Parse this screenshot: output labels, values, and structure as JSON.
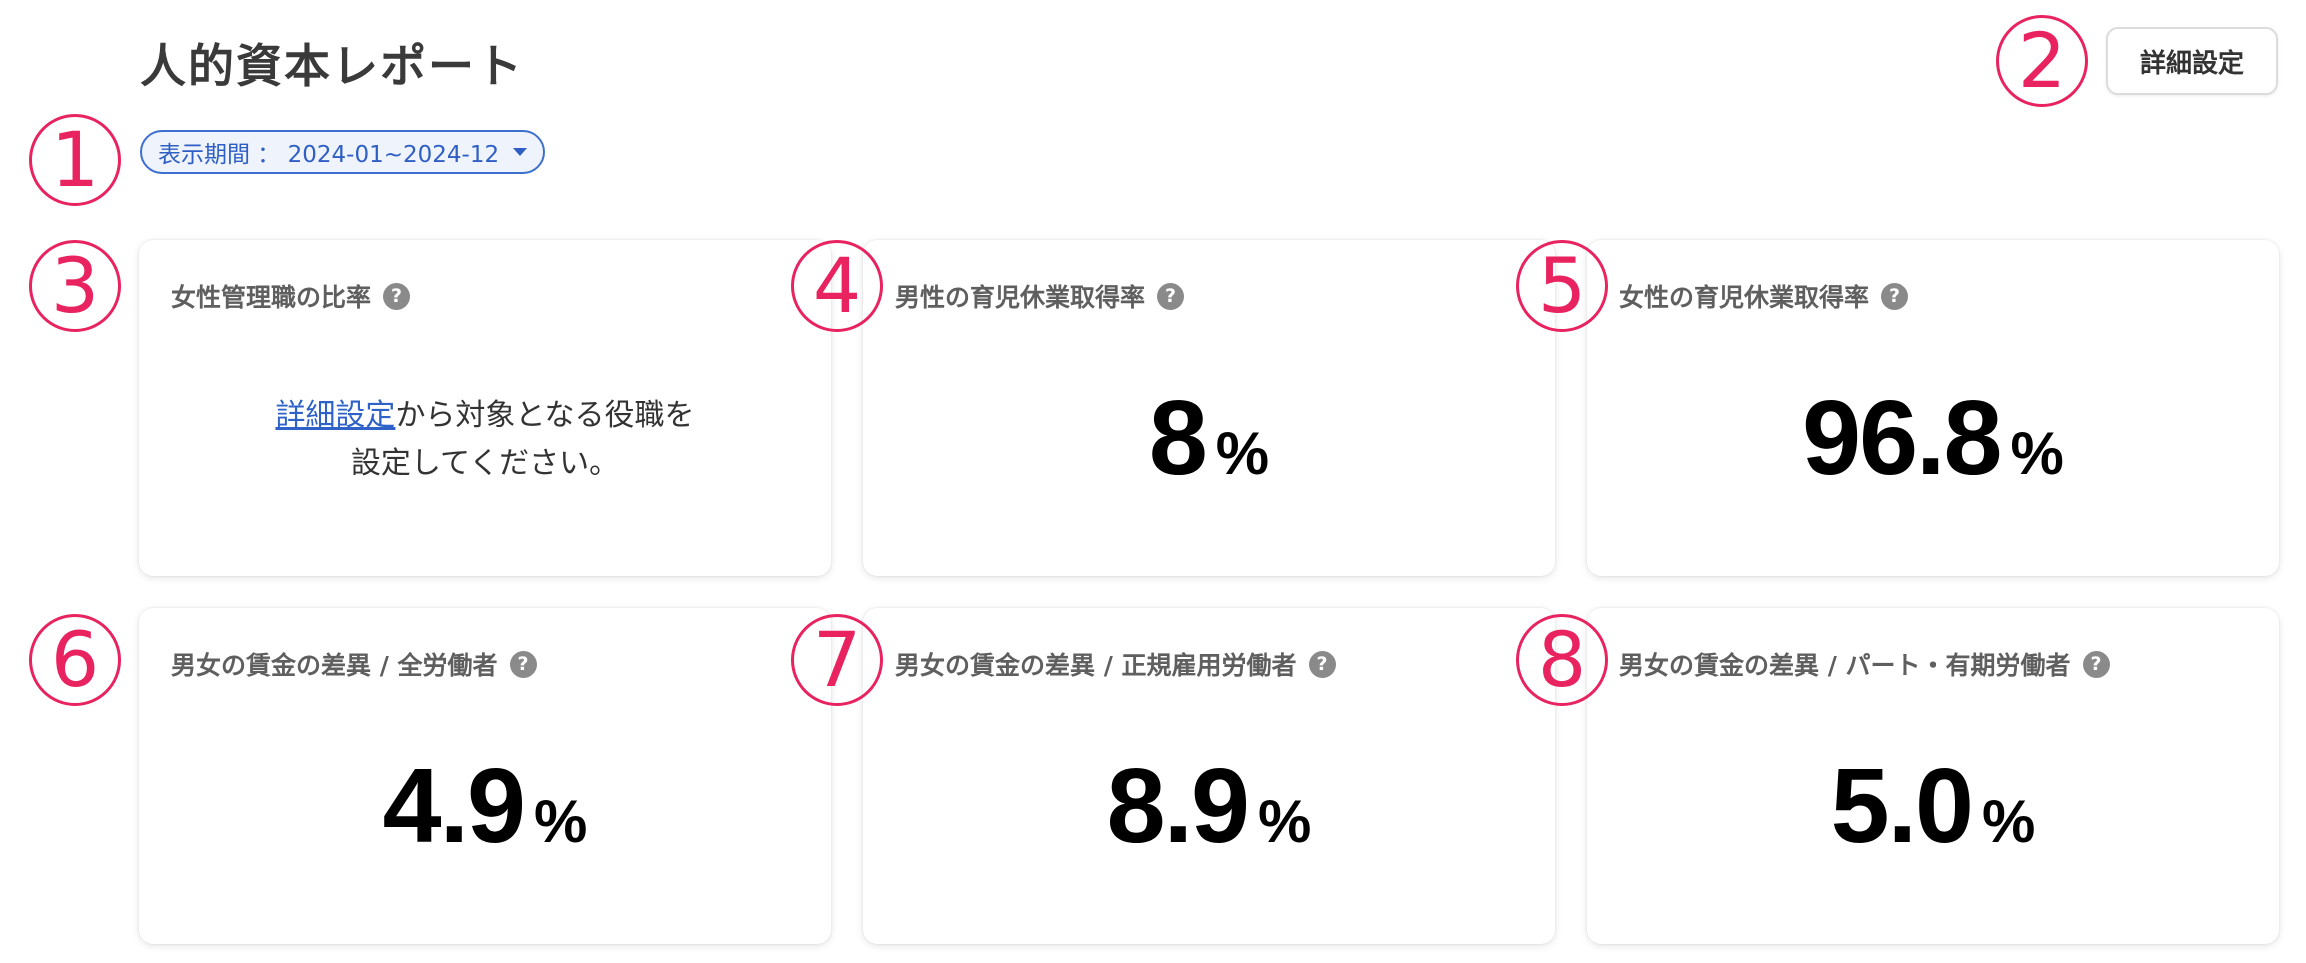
{
  "page": {
    "title": "人的資本レポート",
    "settings_button": "詳細設定",
    "period_filter": "表示期間 ： 2024-01~2024-12"
  },
  "markers": [
    "1",
    "2",
    "3",
    "4",
    "5",
    "6",
    "7",
    "8"
  ],
  "cards": [
    {
      "label": "女性管理職の比率",
      "notice_link": "詳細設定",
      "notice_text1": "から対象となる役職を",
      "notice_text2": "設定してください。"
    },
    {
      "label": "男性の育児休業取得率",
      "value": "8",
      "unit": "%"
    },
    {
      "label": "女性の育児休業取得率",
      "value": "96.8",
      "unit": "%"
    },
    {
      "label": "男女の賃金の差異 / 全労働者",
      "value": "4.9",
      "unit": "%"
    },
    {
      "label": "男女の賃金の差異 / 正規雇用労働者",
      "value": "8.9",
      "unit": "%"
    },
    {
      "label": "男女の賃金の差異 / パート・有期労働者",
      "value": "5.0",
      "unit": "%"
    }
  ],
  "icons": {
    "help": "question-circle-icon",
    "dropdown": "caret-down-icon"
  },
  "colors": {
    "accent": "#3d6fcf",
    "marker": "#e8235f",
    "link": "#2f62c8"
  }
}
